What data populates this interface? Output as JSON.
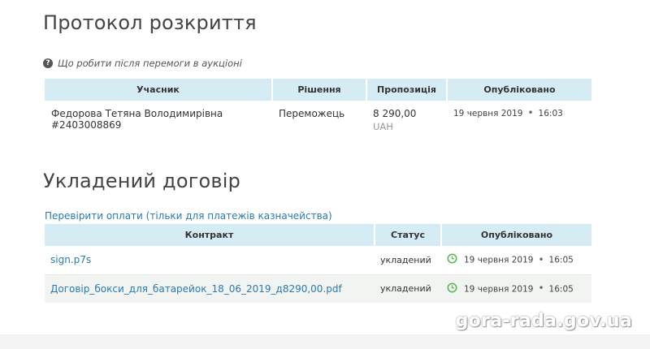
{
  "protocol": {
    "title": "Протокол розкриття",
    "help_text": "Що робити після перемоги в аукціоні",
    "help_icon": "question-icon",
    "columns": [
      "Учасник",
      "Рішення",
      "Пропозиція",
      "Опубліковано"
    ],
    "rows": [
      {
        "participant_name": "Федорова Тетяна Володимирівна",
        "participant_id": "#2403008869",
        "decision": "Переможець",
        "amount": "8 290,00",
        "currency": "UAH",
        "date": "19 червня 2019",
        "time": "16:03"
      }
    ]
  },
  "contract": {
    "title": "Укладений договір",
    "check_link": "Перевірити оплати (тільки для платежів казначейства)",
    "columns": [
      "Контракт",
      "Статус",
      "Опубліковано"
    ],
    "rows": [
      {
        "file": "sign.p7s",
        "status": "укладений",
        "date": "19 червня 2019",
        "time": "16:05",
        "icon": "clock-icon"
      },
      {
        "file": "Договір_бокси_для_батарейок_18_06_2019_д8290,00.pdf",
        "status": "укладений",
        "date": "19 червня 2019",
        "time": "16:05",
        "icon": "clock-icon"
      }
    ]
  },
  "watermark": "gora-rada.gov.ua",
  "colors": {
    "header_bg": "#d6ecf5",
    "link": "#2a7bb0",
    "clock": "#5cb85c"
  }
}
